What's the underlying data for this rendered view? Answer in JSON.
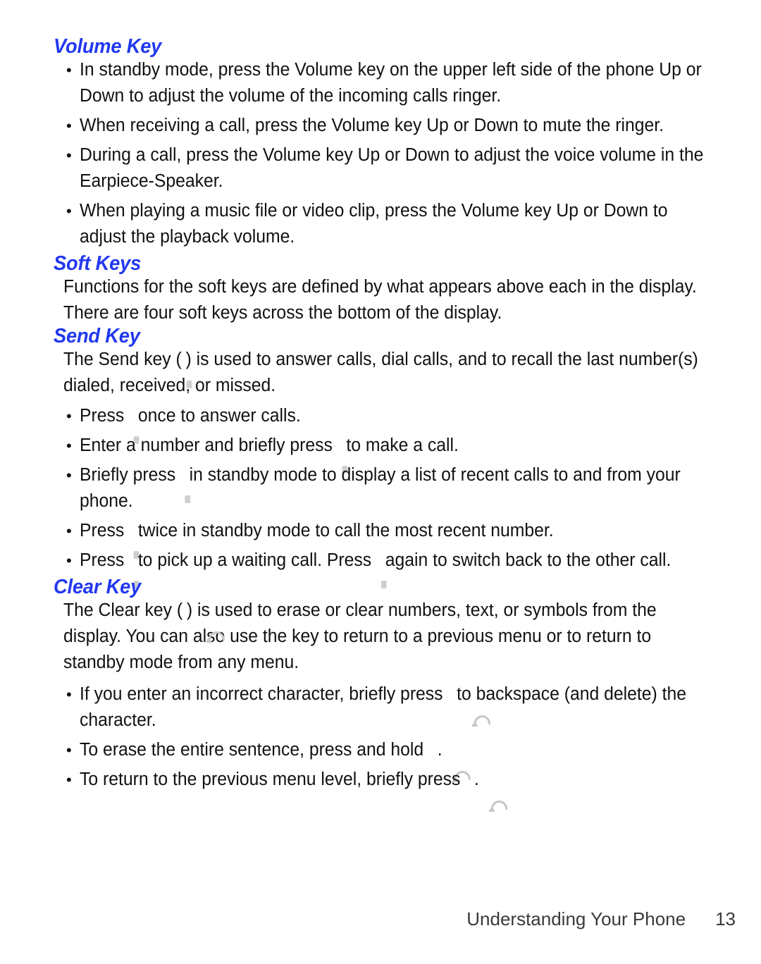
{
  "page": {
    "footer_text": "Understanding Your Phone",
    "page_number": "13",
    "heading_color": "#2138f0",
    "body_color": "#111111"
  },
  "sections": {
    "volume_key": {
      "heading": "Volume Key",
      "bullets": [
        "In standby mode, press the Volume key on the upper left side of the phone Up or Down to adjust the volume of the incoming calls ringer.",
        "When receiving a call, press the Volume key Up or Down to mute the ringer.",
        "During a call, press the Volume key Up or Down to adjust the voice volume in the Earpiece-Speaker.",
        "When playing a music file or video clip, press the Volume key Up or Down to adjust the playback volume."
      ]
    },
    "soft_keys": {
      "heading": "Soft Keys",
      "paragraph": "Functions for the soft keys are defined by what appears above each in the display. There are four soft keys across the bottom of the display."
    },
    "send_key": {
      "heading": "Send Key",
      "intro": {
        "before_icon": "The Send key (",
        "icon": "send-key-icon",
        "after_icon": ") is used to answer calls, dial calls, and to recall the last number(s) dialed, received, or missed."
      },
      "bullets": [
        {
          "before_icon": "Press",
          "icon": "send-key-icon",
          "after_icon": "once to answer calls."
        },
        {
          "before_icon": "Enter a number and briefly press",
          "icon": "send-key-icon",
          "after_icon": "to make a call."
        },
        {
          "before_icon": "Briefly press",
          "icon": "send-key-icon",
          "after_icon": "in standby mode to display a list of recent calls to and from your phone."
        },
        {
          "before_icon": "Press",
          "icon": "send-key-icon",
          "after_icon": "twice in standby mode to call the most recent number."
        },
        {
          "before_icon": "Press",
          "icon": "send-key-icon",
          "mid_text": "to pick up a waiting call. Press",
          "icon2": "send-key-icon",
          "after_icon": "again to switch back to the other call."
        }
      ]
    },
    "clear_key": {
      "heading": "Clear Key",
      "intro": {
        "before_icon": "The Clear key (",
        "icon": "clear-key-icon",
        "after_icon": ") is used to erase or clear numbers, text, or symbols from the display. You can also use the key to return to a previous menu or to return to standby mode from any menu."
      },
      "bullets": [
        {
          "before_icon": "If you enter an incorrect character, briefly press",
          "icon": "clear-key-icon",
          "after_icon": "to backspace (and delete) the character."
        },
        {
          "before_icon": "To erase the entire sentence, press and hold",
          "icon": "clear-key-icon",
          "after_icon": "."
        },
        {
          "before_icon": "To return to the previous menu level, briefly press",
          "icon": "clear-key-icon",
          "after_icon": "."
        }
      ]
    }
  }
}
